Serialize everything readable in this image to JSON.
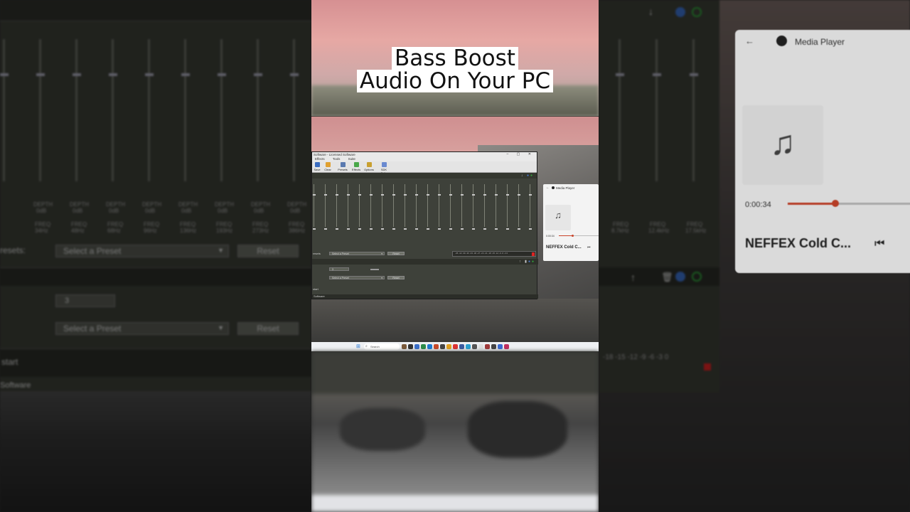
{
  "headline": {
    "line1": "Bass Boost",
    "line2": "Audio On Your PC"
  },
  "background_left": {
    "band_label": "DEPTH",
    "band_value": "0dB",
    "freq_label": "FREQ",
    "freqs": [
      "34Hz",
      "48Hz",
      "68Hz",
      "96Hz",
      "136Hz",
      "193Hz",
      "273Hz",
      "386Hz"
    ],
    "presets_label": "resets:",
    "preset_select": "Select a Preset",
    "reset_label": "Reset",
    "field_value": "3",
    "preset_select_2": "Select a Preset",
    "reset_label_2": "Reset",
    "start_label": "start",
    "software_label": "Software"
  },
  "background_right": {
    "freq_label": "FREQ",
    "freqs": [
      "8.7kHz",
      "12.4kHz",
      "17.5kHz"
    ],
    "meter_ticks": "-18  -15  -12   -9   -6   -3    0",
    "media_player": {
      "title": "Media Player",
      "time": "0:00:34",
      "song": "NEFFEX  Cold C...",
      "progress_fraction": 0.35
    }
  },
  "screen": {
    "eq_window": {
      "title": "Software - Licensed Software",
      "menu": [
        "Effects",
        "Tools",
        "Suite"
      ],
      "tools": [
        "Save",
        "Clear",
        "Presets",
        "Effects",
        "Options",
        "SDK Suite"
      ],
      "presets_label": "resets",
      "preset_select": "Select a Preset",
      "reset_label": "Reset",
      "field_value": "3",
      "preset_select_2": "Select a Preset",
      "reset_label_2": "Reset",
      "start_label": "start",
      "status": "Software",
      "meter_ticks": "-45 -42 -39 -36 -33 -30 -27 -24 -21 -18 -15 -12 -9 -6 -3 0"
    },
    "media_player": {
      "title": "Media Player",
      "time": "0:00:34",
      "song": "NEFFEX  Cold C...",
      "progress_fraction": 0.35
    },
    "taskbar": {
      "search_placeholder": "Search"
    }
  },
  "colors": {
    "eq_bg": "#3e413a",
    "accent_progress": "#c9442a",
    "headline_bg": "#ffffff"
  }
}
